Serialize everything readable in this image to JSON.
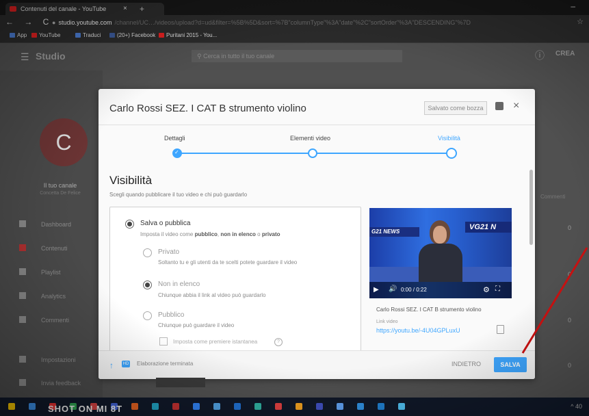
{
  "browser": {
    "tab_title": "Contenuti del canale - YouTube",
    "tab_close": "×",
    "new_tab": "+",
    "nav_glyphs": "← → C",
    "address_host": "studio.youtube.com",
    "address_rest": "/channel/UC…/videos/upload?d=ud&filter=%5B%5D&sort=%7B\"columnType\"%3A\"date\"%2C\"sortOrder\"%3A\"DESCENDING\"%7D",
    "bookmarks": [
      {
        "label": "App",
        "color": "#4a7bd0"
      },
      {
        "label": "YouTube",
        "color": "#e02020"
      },
      {
        "label": "Traduci",
        "color": "#4a7bd0"
      },
      {
        "label": "(20+) Facebook",
        "color": "#3b5998"
      },
      {
        "label": "Puritani 2015 - You...",
        "color": "#e02020"
      }
    ]
  },
  "studio": {
    "logo": "Studio",
    "search_placeholder": "Cerca in tutto il tuo canale",
    "create_label": "CREA",
    "avatar_letter": "C",
    "channel_label": "Il tuo canale",
    "channel_sub": "Concetta De Felice",
    "sidebar": [
      {
        "label": "Dashboard",
        "icon": "dashboard-icon"
      },
      {
        "label": "Contenuti",
        "icon": "content-icon",
        "active": true
      },
      {
        "label": "Playlist",
        "icon": "playlist-icon"
      },
      {
        "label": "Analytics",
        "icon": "analytics-icon"
      },
      {
        "label": "Commenti",
        "icon": "comments-icon"
      },
      {
        "label": "Impostazioni",
        "icon": "settings-icon"
      },
      {
        "label": "Invia feedback",
        "icon": "feedback-icon"
      }
    ],
    "comments_col": "Commenti",
    "zeros": [
      "0",
      "0",
      "0",
      "0",
      "0"
    ]
  },
  "modal": {
    "title": "Carlo Rossi SEZ. I CAT B strumento violino",
    "draft_label": "Salvato come bozza",
    "close": "×",
    "steps": [
      {
        "label": "Dettagli",
        "state": "done"
      },
      {
        "label": "Elementi video",
        "state": "todo"
      },
      {
        "label": "Visibilità",
        "state": "active"
      }
    ],
    "section_title": "Visibilità",
    "section_sub": "Scegli quando pubblicare il tuo video e chi può guardarlo",
    "save_publish": {
      "label": "Salva o pubblica",
      "desc_prefix": "Imposta il video come ",
      "desc_a": "pubblico",
      "desc_b": ", ",
      "desc_c": "non in elenco",
      "desc_d": " o ",
      "desc_e": "privato"
    },
    "options": [
      {
        "label": "Privato",
        "desc": "Soltanto tu e gli utenti da te scelti potete guardare il video",
        "selected": false
      },
      {
        "label": "Non in elenco",
        "desc": "Chiunque abbia il link al video può guardarlo",
        "selected": true
      },
      {
        "label": "Pubblico",
        "desc": "Chiunque può guardare il video",
        "selected": false
      }
    ],
    "premiere_label": "Imposta come premiere istantanea",
    "video": {
      "ticker_left": "G21 NEWS",
      "ticker_right": "VG21 N",
      "time": "0:00 / 0:22",
      "title": "Carlo Rossi SEZ. I CAT B strumento violino",
      "link_label": "Link video",
      "link": "https://youtu.be/-4U04GPLuxU"
    },
    "processing": "Elaborazione terminata",
    "back_label": "INDIETRO",
    "save_label": "SALVA"
  },
  "taskbar": {
    "watermark": "SHOT ON MI 8T",
    "tray": "^ 40",
    "icon_colors": [
      "#f0c000",
      "#3a8be0",
      "#e03030",
      "#30a050",
      "#d04040",
      "#4060d0",
      "#e06020",
      "#20a0c0",
      "#c03030",
      "#3080f0",
      "#50a0e0",
      "#2070d0",
      "#30b0a0",
      "#e04040",
      "#f0a020",
      "#4050c0",
      "#60a0f0",
      "#3090e0",
      "#2080d0",
      "#50c0f0"
    ]
  },
  "annotation": {
    "arrow_color": "#cc1111"
  }
}
